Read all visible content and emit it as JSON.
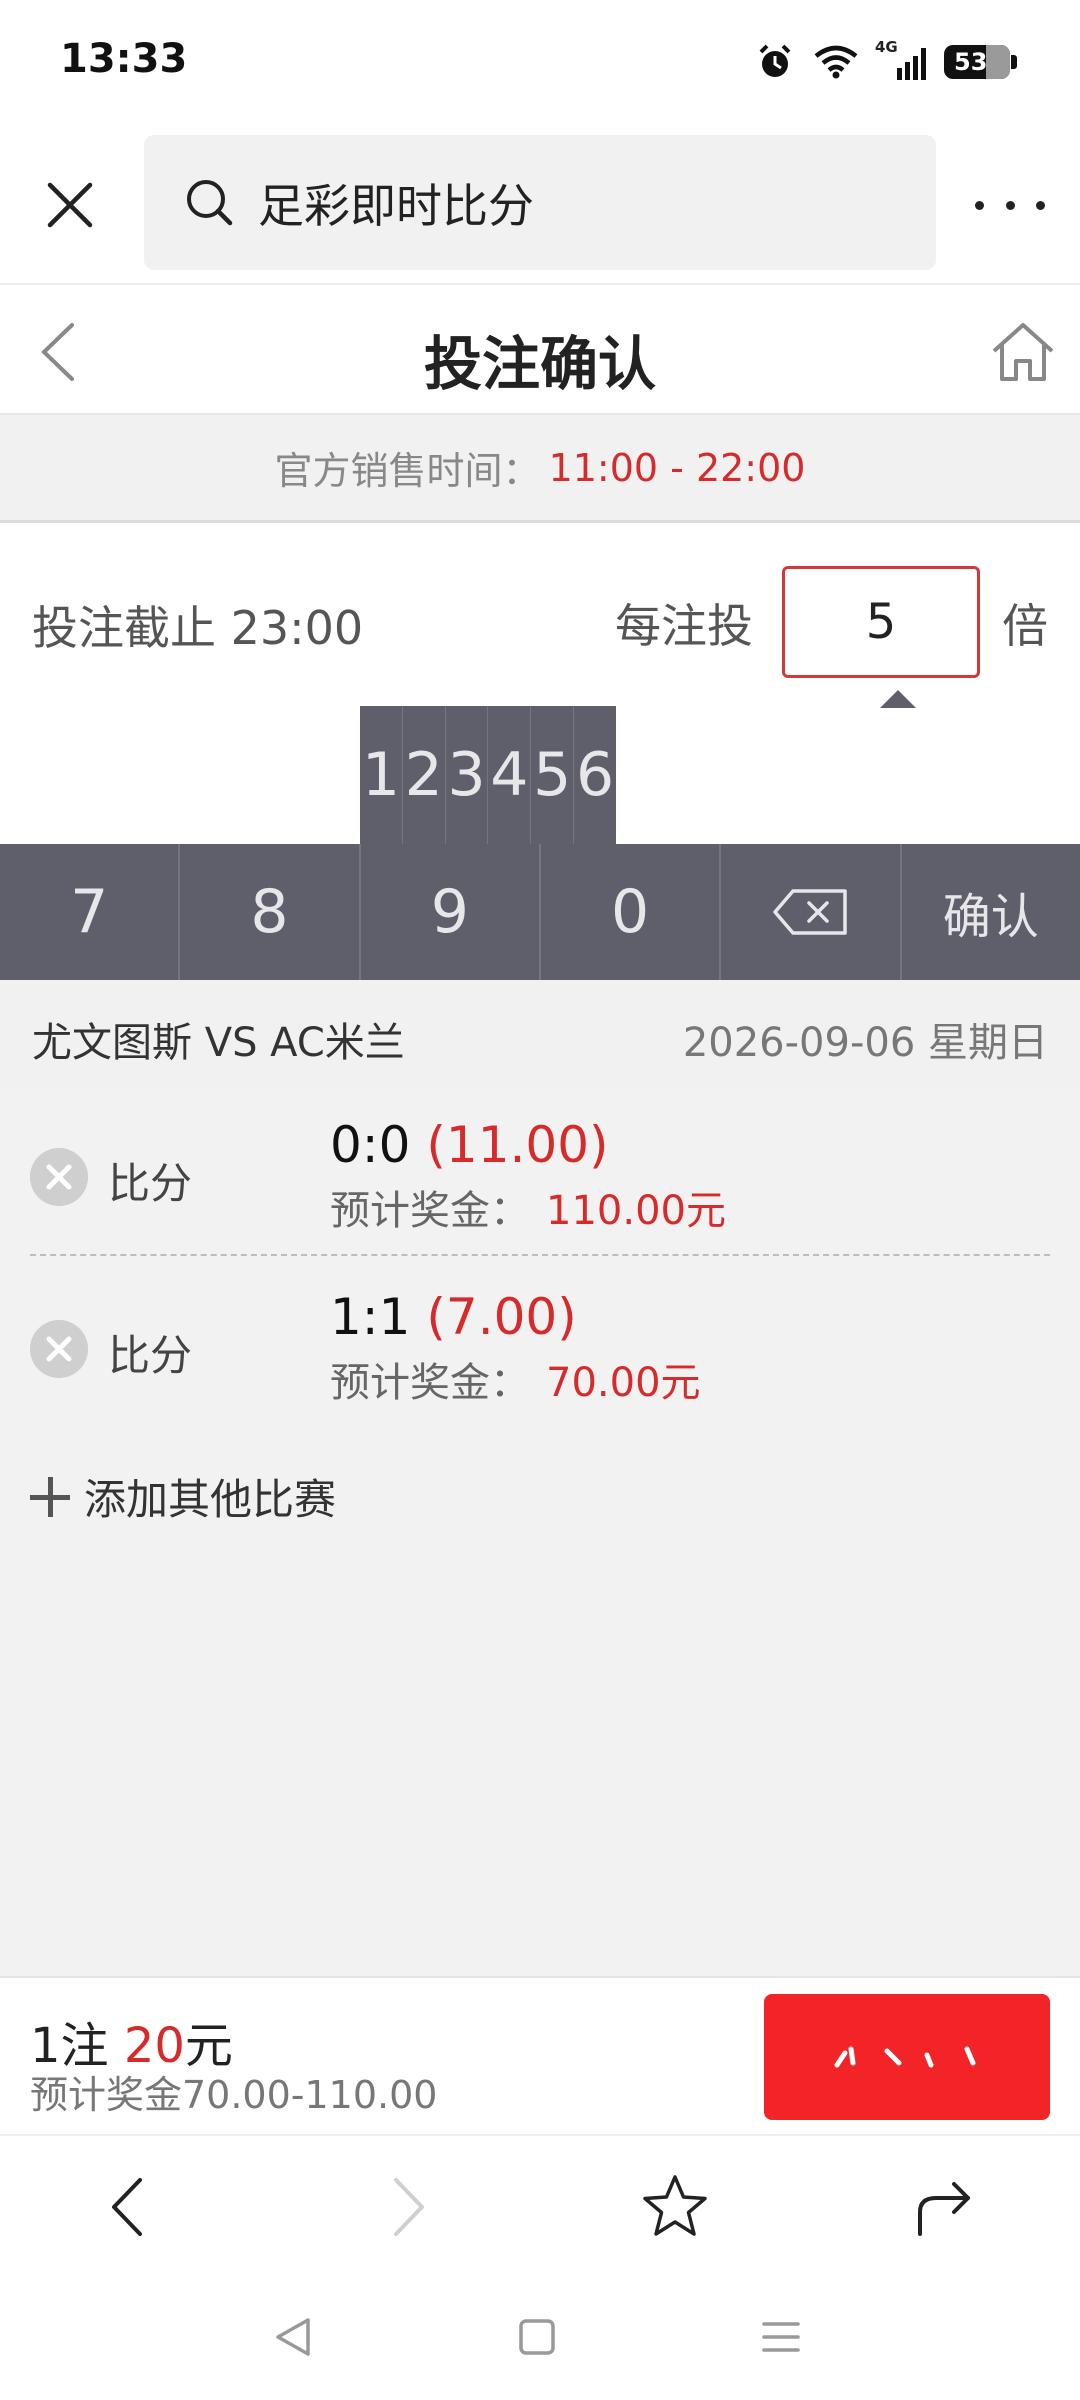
{
  "status_bar": {
    "time": "13:33",
    "network": "4G",
    "battery": "53"
  },
  "browser": {
    "search_text": "足彩即时比分"
  },
  "page": {
    "title": "投注确认"
  },
  "sales_time": {
    "label": "官方销售时间：",
    "value": "11:00 - 22:00"
  },
  "bet_settings": {
    "deadline": "投注截止 23:00",
    "per_bet_label": "每注投",
    "multiplier": "5",
    "times_label": "倍"
  },
  "keypad": {
    "top_keys": [
      "1",
      "2",
      "3",
      "4",
      "5",
      "6"
    ],
    "bottom_keys": [
      "7",
      "8",
      "9",
      "0"
    ],
    "confirm_label": "确认"
  },
  "match": {
    "name": "尤文图斯 VS AC米兰",
    "date": "2026-09-06 星期日"
  },
  "bets": [
    {
      "type": "比分",
      "score": "0:0",
      "odds": "(11.00)",
      "prize_label": "预计奖金：",
      "prize": "110.00元"
    },
    {
      "type": "比分",
      "score": "1:1",
      "odds": "(7.00)",
      "prize_label": "预计奖金：",
      "prize": "70.00元"
    }
  ],
  "add_match_label": "添加其他比赛",
  "summary": {
    "count": "1注",
    "amount": "20",
    "unit": "元",
    "prize_range": "预计奖金70.00-110.00"
  },
  "colors": {
    "accent_red": "#d62b2b",
    "submit_red": "#f22428",
    "keypad_bg": "#5e5f6b"
  }
}
